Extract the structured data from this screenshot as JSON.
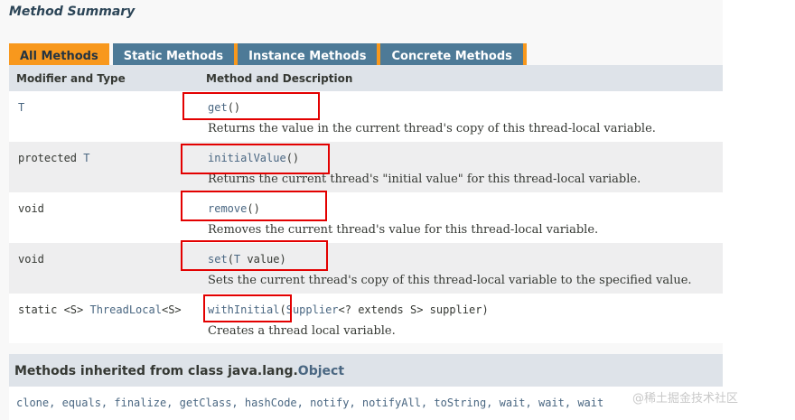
{
  "section_title": "Method Summary",
  "tabs": [
    {
      "label": "All Methods"
    },
    {
      "label": "Static Methods"
    },
    {
      "label": "Instance Methods"
    },
    {
      "label": "Concrete Methods"
    }
  ],
  "columns": {
    "modifier": "Modifier and Type",
    "method": "Method and Description"
  },
  "methods": [
    {
      "modifier_prefix": "",
      "modifier_link": "T",
      "modifier_suffix": "",
      "name": "get",
      "params": "()",
      "description": "Returns the value in the current thread's copy of this thread-local variable."
    },
    {
      "modifier_prefix": "protected ",
      "modifier_link": "T",
      "modifier_suffix": "",
      "name": "initialValue",
      "params": "()",
      "description": "Returns the current thread's \"initial value\" for this thread-local variable."
    },
    {
      "modifier_prefix": "void",
      "modifier_link": "",
      "modifier_suffix": "",
      "name": "remove",
      "params": "()",
      "description": "Removes the current thread's value for this thread-local variable."
    },
    {
      "modifier_prefix": "void",
      "modifier_link": "",
      "modifier_suffix": "",
      "name": "set",
      "params_prefix": "(",
      "params_link": "T",
      "params_suffix": " value)",
      "description": "Sets the current thread's copy of this thread-local variable to the specified value."
    },
    {
      "modifier_prefix": "static <S> ",
      "modifier_link": "ThreadLocal",
      "modifier_suffix": "<S>",
      "name": "withInitial",
      "params_prefix": "(",
      "params_link": "Supplier",
      "params_suffix": "<? extends S> supplier)",
      "description": "Creates a thread local variable."
    }
  ],
  "inherited": {
    "heading_prefix": "Methods inherited from class java.lang.",
    "heading_link": "Object",
    "methods": "clone, equals, finalize, getClass, hashCode, notify, notifyAll, toString, wait, wait, wait"
  },
  "watermark": "@稀土掘金技术社区",
  "colors": {
    "active_tab": "#f8981d",
    "inactive_tab": "#4d7a97",
    "header_bg": "#dee3e9",
    "link": "#4a6782",
    "highlight": "#e30000"
  }
}
